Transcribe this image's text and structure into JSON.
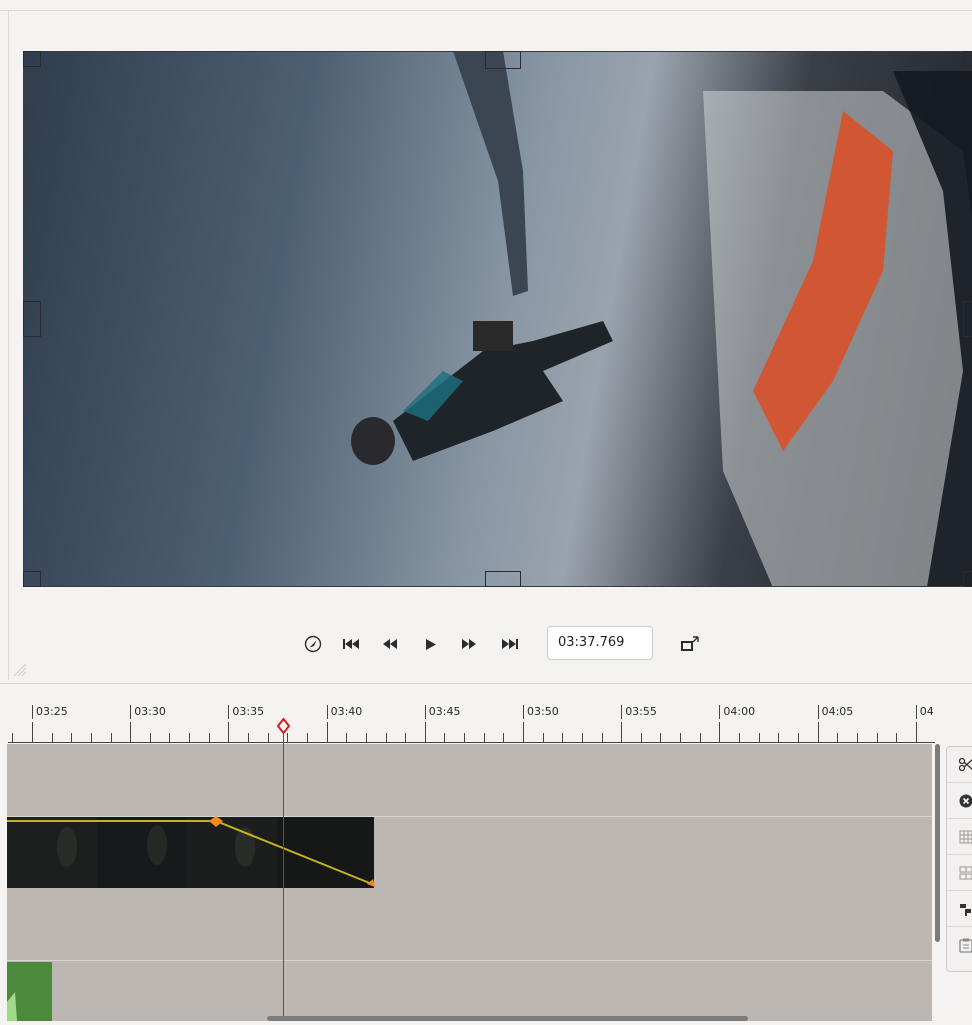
{
  "transport": {
    "timecode": "03:37.769",
    "buttons": [
      {
        "name": "safe-area-icon"
      },
      {
        "name": "go-to-start-icon"
      },
      {
        "name": "step-back-icon"
      },
      {
        "name": "play-icon"
      },
      {
        "name": "step-forward-icon"
      },
      {
        "name": "go-to-end-icon"
      }
    ],
    "detach_icon": "detach-viewer-icon"
  },
  "ruler": {
    "labels": [
      "03:25",
      "03:30",
      "03:35",
      "03:40",
      "03:45",
      "03:50",
      "03:55",
      "04:00",
      "04:05",
      "04"
    ]
  },
  "tools": [
    {
      "name": "split-clip-icon"
    },
    {
      "name": "remove-clip-icon"
    },
    {
      "name": "group-clips-icon"
    },
    {
      "name": "ungroup-clips-icon"
    },
    {
      "name": "align-clips-icon"
    },
    {
      "name": "paste-attributes-icon"
    }
  ],
  "colors": {
    "playhead": "#e0191b",
    "keyframe": "#f08c1a",
    "keyframe_line": "#c7b31a",
    "track_bg": "#bdb7b3",
    "clip_green": "#4b8a3a"
  }
}
